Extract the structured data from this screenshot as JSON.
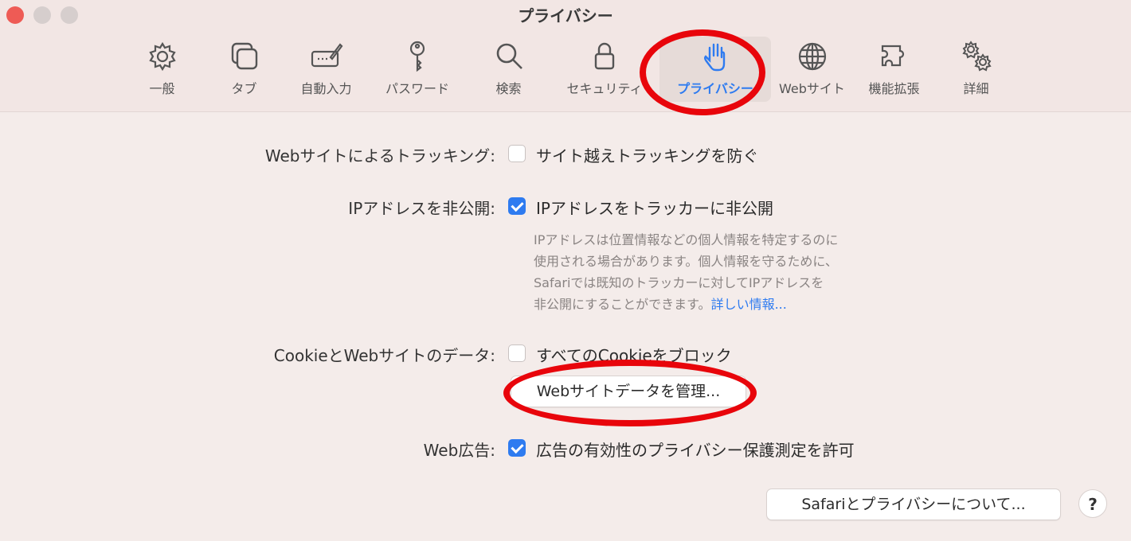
{
  "window": {
    "title": "プライバシー"
  },
  "toolbar": {
    "tabs": [
      {
        "label": "一般",
        "icon": "gear-icon"
      },
      {
        "label": "タブ",
        "icon": "tabs-icon"
      },
      {
        "label": "自動入力",
        "icon": "autofill-icon"
      },
      {
        "label": "パスワード",
        "icon": "key-icon"
      },
      {
        "label": "検索",
        "icon": "search-icon"
      },
      {
        "label": "セキュリティ",
        "icon": "lock-icon"
      },
      {
        "label": "プライバシー",
        "icon": "hand-icon",
        "selected": true
      },
      {
        "label": "Webサイト",
        "icon": "globe-icon"
      },
      {
        "label": "機能拡張",
        "icon": "puzzle-icon"
      },
      {
        "label": "詳細",
        "icon": "gears-icon"
      }
    ]
  },
  "tracking": {
    "label": "Webサイトによるトラッキング:",
    "option": "サイト越えトラッキングを防ぐ",
    "checked": false
  },
  "ip": {
    "label": "IPアドレスを非公開:",
    "option": "IPアドレスをトラッカーに非公開",
    "checked": true,
    "desc": [
      "IPアドレスは位置情報などの個人情報を特定するのに",
      "使用される場合があります。個人情報を守るために、",
      "Safariでは既知のトラッカーに対してIPアドレスを",
      "非公開にすることができます。"
    ],
    "link": "詳しい情報..."
  },
  "cookies": {
    "label": "CookieとWebサイトのデータ:",
    "option": "すべてのCookieをブロック",
    "checked": false,
    "manage_button": "Webサイトデータを管理..."
  },
  "ads": {
    "label": "Web広告:",
    "option": "広告の有効性のプライバシー保護測定を許可",
    "checked": true
  },
  "footer": {
    "about_button": "Safariとプライバシーについて...",
    "help_button": "?"
  },
  "colors": {
    "accent": "#2e7bf0",
    "annotation": "#e8050b",
    "close": "#ee5b55"
  }
}
